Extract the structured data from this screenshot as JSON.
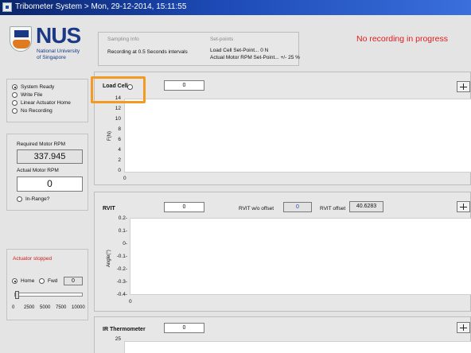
{
  "window": {
    "title": "Tribometer System > Mon, 29-12-2014, 15:11:55"
  },
  "logo": {
    "name": "NUS",
    "line1": "National University",
    "line2": "of Singapore"
  },
  "info": {
    "sampling_header": "Sampling Info",
    "sampling_text": "Recording at 0.5 Seconds intervals",
    "setpoints_header": "Set-points",
    "setpoint_load": "Load Cell Set-Point... 0 N",
    "setpoint_rpm": "Actual Motor RPM Set-Point... +/- 25 %"
  },
  "recording_status": "No recording in progress",
  "mode_options": [
    {
      "label": "System Ready",
      "selected": true
    },
    {
      "label": "Write File",
      "selected": false
    },
    {
      "label": "Linear Actuator Home",
      "selected": false
    },
    {
      "label": "No Recording",
      "selected": false
    }
  ],
  "motor": {
    "required_label": "Required Motor RPM",
    "required_value": "337.945",
    "actual_label": "Actual Motor RPM",
    "actual_value": "0",
    "in_range_label": "In-Range?"
  },
  "actuator": {
    "status": "Actuator stopped",
    "home_label": "Home",
    "fwd_label": "Fwd",
    "value": "0",
    "slider_ticks": [
      "0",
      "2500",
      "5000",
      "7500",
      "10000"
    ],
    "slider_level": 0
  },
  "load_cell": {
    "label": "Load Cell",
    "value": "0",
    "ylabel": "F(N)",
    "yticks": [
      "14",
      "12",
      "10",
      "8",
      "6",
      "4",
      "2",
      "0"
    ],
    "xtick": "0"
  },
  "rvit": {
    "label": "RVIT",
    "value": "0",
    "no_offset_label": "RVIT w/o offset",
    "no_offset_value": "0",
    "offset_label": "RVIT offset",
    "offset_value": "40.6283",
    "ylabel": "Angle(°)",
    "yticks": [
      "0.2-",
      "0.1-",
      "0-",
      "-0.1-",
      "-0.2-",
      "-0.3-",
      "-0.4-"
    ],
    "xtick": "0"
  },
  "ir": {
    "label": "IR Thermometer",
    "value": "0",
    "ytick_top": "25"
  },
  "colors": {
    "title_bar": "#1c49b4",
    "status_red": "#e01b1b",
    "highlight": "#f29a22"
  }
}
